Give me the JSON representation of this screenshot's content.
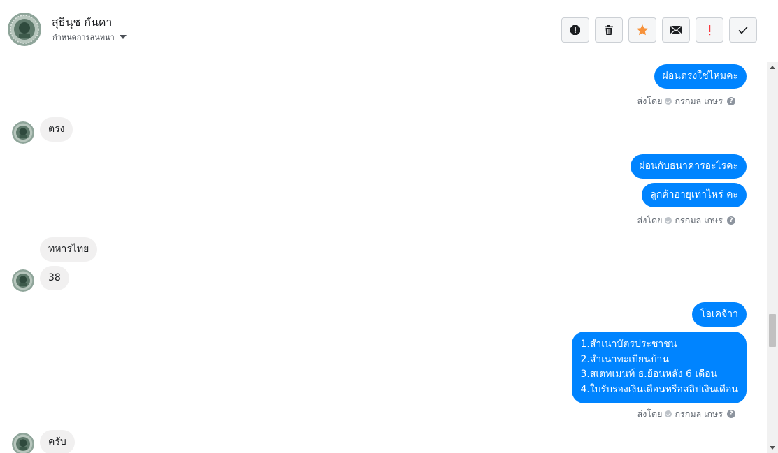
{
  "header": {
    "contact_name": "สุธินุช กันดา",
    "subtitle": "กำหนดการสนทนา",
    "actions": [
      {
        "name": "report-spam-icon",
        "label": "report"
      },
      {
        "name": "trash-icon",
        "label": "delete"
      },
      {
        "name": "star-icon",
        "label": "star"
      },
      {
        "name": "envelope-icon",
        "label": "mark-unread"
      },
      {
        "name": "exclamation-icon",
        "label": "important"
      },
      {
        "name": "check-icon",
        "label": "done"
      }
    ],
    "accent_star": "#f7923b",
    "accent_important": "#fa383e"
  },
  "messages": {
    "out_1": "ผ่อนตรงใช่ไหมคะ",
    "sent_by_1": "ส่งโดย",
    "sender_1": "กรกมล เกษร",
    "in_1": "ตรง",
    "out_2": "ผ่อนกับธนาคารอะไรคะ",
    "out_3": "ลูกค้าอายุเท่าไหร่ คะ",
    "sent_by_2": "ส่งโดย",
    "sender_2": "กรกมล เกษร",
    "in_2": "ทหารไทย",
    "in_3": "38",
    "out_4": "โอเคจ้าา",
    "out_5_lines": [
      "1.สำเนาบัตรประชาชน",
      "2.สำเนาทะเบียนบ้าน",
      "3.สเตทเมนท์ ธ.ย้อนหลัง 6 เดือน",
      "4.ใบรับรองเงินเดือนหรือสลิปเงินเดือน"
    ],
    "sent_by_3": "ส่งโดย",
    "sender_3": "กรกมล เกษร",
    "in_4": "ครับ"
  },
  "colors": {
    "outgoing_bubble": "#0084ff",
    "incoming_bubble": "#f1f0f0"
  }
}
